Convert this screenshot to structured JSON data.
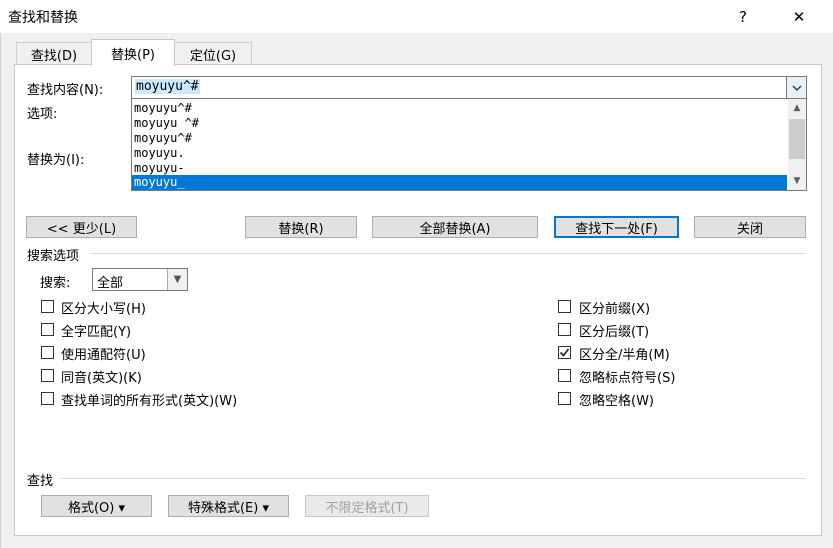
{
  "window": {
    "title": "查找和替换",
    "help": "?",
    "close": "✕"
  },
  "tabs": [
    {
      "label": "查找(D)"
    },
    {
      "label": "替换(P)"
    },
    {
      "label": "定位(G)"
    }
  ],
  "find": {
    "label": "查找内容(N):",
    "value": "moyuyu^#"
  },
  "options_label": "选项:",
  "replace": {
    "label": "替换为(I):"
  },
  "dropdown": {
    "items": [
      "moyuyu^#",
      "moyuyu ^#",
      "moyuyu^#",
      "moyuyu.",
      "moyuyu-",
      "moyuyu_"
    ],
    "selected_index": 5
  },
  "buttons": {
    "less": "<< 更少(L)",
    "replace": "替换(R)",
    "replace_all": "全部替换(A)",
    "find_next": "查找下一处(F)",
    "close": "关闭"
  },
  "search_options": {
    "title": "搜索选项",
    "search_label": "搜索:",
    "search_value": "全部",
    "left": [
      {
        "label": "区分大小写(H)",
        "checked": false
      },
      {
        "label": "全字匹配(Y)",
        "checked": false
      },
      {
        "label": "使用通配符(U)",
        "checked": false
      },
      {
        "label": "同音(英文)(K)",
        "checked": false
      },
      {
        "label": "查找单词的所有形式(英文)(W)",
        "checked": false
      }
    ],
    "right": [
      {
        "label": "区分前缀(X)",
        "checked": false
      },
      {
        "label": "区分后缀(T)",
        "checked": false
      },
      {
        "label": "区分全/半角(M)",
        "checked": true
      },
      {
        "label": "忽略标点符号(S)",
        "checked": false
      },
      {
        "label": "忽略空格(W)",
        "checked": false
      }
    ]
  },
  "find_section": {
    "title": "查找",
    "format": "格式(O) ▾",
    "special": "特殊格式(E) ▾",
    "no_format": "不限定格式(T)"
  }
}
